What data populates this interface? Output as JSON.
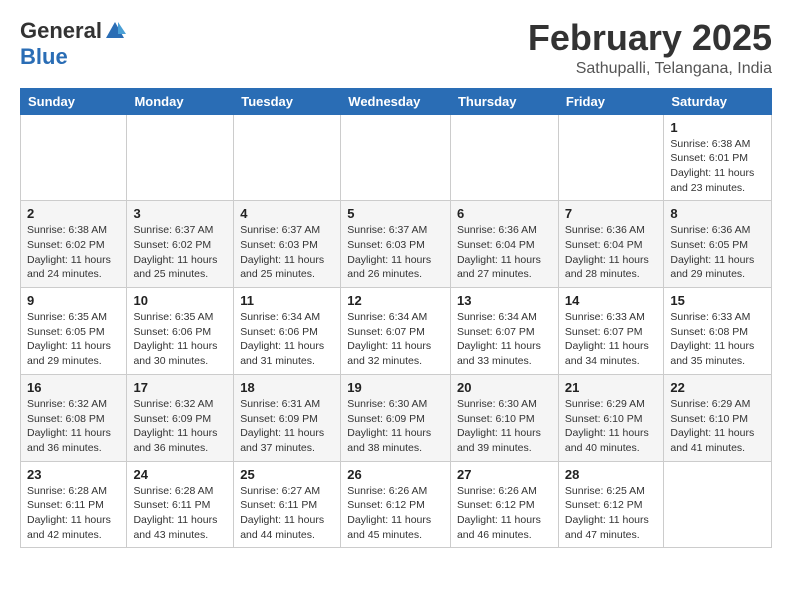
{
  "header": {
    "logo_general": "General",
    "logo_blue": "Blue",
    "month_title": "February 2025",
    "subtitle": "Sathupalli, Telangana, India"
  },
  "weekdays": [
    "Sunday",
    "Monday",
    "Tuesday",
    "Wednesday",
    "Thursday",
    "Friday",
    "Saturday"
  ],
  "weeks": [
    [
      {
        "day": "",
        "info": ""
      },
      {
        "day": "",
        "info": ""
      },
      {
        "day": "",
        "info": ""
      },
      {
        "day": "",
        "info": ""
      },
      {
        "day": "",
        "info": ""
      },
      {
        "day": "",
        "info": ""
      },
      {
        "day": "1",
        "info": "Sunrise: 6:38 AM\nSunset: 6:01 PM\nDaylight: 11 hours\nand 23 minutes."
      }
    ],
    [
      {
        "day": "2",
        "info": "Sunrise: 6:38 AM\nSunset: 6:02 PM\nDaylight: 11 hours\nand 24 minutes."
      },
      {
        "day": "3",
        "info": "Sunrise: 6:37 AM\nSunset: 6:02 PM\nDaylight: 11 hours\nand 25 minutes."
      },
      {
        "day": "4",
        "info": "Sunrise: 6:37 AM\nSunset: 6:03 PM\nDaylight: 11 hours\nand 25 minutes."
      },
      {
        "day": "5",
        "info": "Sunrise: 6:37 AM\nSunset: 6:03 PM\nDaylight: 11 hours\nand 26 minutes."
      },
      {
        "day": "6",
        "info": "Sunrise: 6:36 AM\nSunset: 6:04 PM\nDaylight: 11 hours\nand 27 minutes."
      },
      {
        "day": "7",
        "info": "Sunrise: 6:36 AM\nSunset: 6:04 PM\nDaylight: 11 hours\nand 28 minutes."
      },
      {
        "day": "8",
        "info": "Sunrise: 6:36 AM\nSunset: 6:05 PM\nDaylight: 11 hours\nand 29 minutes."
      }
    ],
    [
      {
        "day": "9",
        "info": "Sunrise: 6:35 AM\nSunset: 6:05 PM\nDaylight: 11 hours\nand 29 minutes."
      },
      {
        "day": "10",
        "info": "Sunrise: 6:35 AM\nSunset: 6:06 PM\nDaylight: 11 hours\nand 30 minutes."
      },
      {
        "day": "11",
        "info": "Sunrise: 6:34 AM\nSunset: 6:06 PM\nDaylight: 11 hours\nand 31 minutes."
      },
      {
        "day": "12",
        "info": "Sunrise: 6:34 AM\nSunset: 6:07 PM\nDaylight: 11 hours\nand 32 minutes."
      },
      {
        "day": "13",
        "info": "Sunrise: 6:34 AM\nSunset: 6:07 PM\nDaylight: 11 hours\nand 33 minutes."
      },
      {
        "day": "14",
        "info": "Sunrise: 6:33 AM\nSunset: 6:07 PM\nDaylight: 11 hours\nand 34 minutes."
      },
      {
        "day": "15",
        "info": "Sunrise: 6:33 AM\nSunset: 6:08 PM\nDaylight: 11 hours\nand 35 minutes."
      }
    ],
    [
      {
        "day": "16",
        "info": "Sunrise: 6:32 AM\nSunset: 6:08 PM\nDaylight: 11 hours\nand 36 minutes."
      },
      {
        "day": "17",
        "info": "Sunrise: 6:32 AM\nSunset: 6:09 PM\nDaylight: 11 hours\nand 36 minutes."
      },
      {
        "day": "18",
        "info": "Sunrise: 6:31 AM\nSunset: 6:09 PM\nDaylight: 11 hours\nand 37 minutes."
      },
      {
        "day": "19",
        "info": "Sunrise: 6:30 AM\nSunset: 6:09 PM\nDaylight: 11 hours\nand 38 minutes."
      },
      {
        "day": "20",
        "info": "Sunrise: 6:30 AM\nSunset: 6:10 PM\nDaylight: 11 hours\nand 39 minutes."
      },
      {
        "day": "21",
        "info": "Sunrise: 6:29 AM\nSunset: 6:10 PM\nDaylight: 11 hours\nand 40 minutes."
      },
      {
        "day": "22",
        "info": "Sunrise: 6:29 AM\nSunset: 6:10 PM\nDaylight: 11 hours\nand 41 minutes."
      }
    ],
    [
      {
        "day": "23",
        "info": "Sunrise: 6:28 AM\nSunset: 6:11 PM\nDaylight: 11 hours\nand 42 minutes."
      },
      {
        "day": "24",
        "info": "Sunrise: 6:28 AM\nSunset: 6:11 PM\nDaylight: 11 hours\nand 43 minutes."
      },
      {
        "day": "25",
        "info": "Sunrise: 6:27 AM\nSunset: 6:11 PM\nDaylight: 11 hours\nand 44 minutes."
      },
      {
        "day": "26",
        "info": "Sunrise: 6:26 AM\nSunset: 6:12 PM\nDaylight: 11 hours\nand 45 minutes."
      },
      {
        "day": "27",
        "info": "Sunrise: 6:26 AM\nSunset: 6:12 PM\nDaylight: 11 hours\nand 46 minutes."
      },
      {
        "day": "28",
        "info": "Sunrise: 6:25 AM\nSunset: 6:12 PM\nDaylight: 11 hours\nand 47 minutes."
      },
      {
        "day": "",
        "info": ""
      }
    ]
  ]
}
